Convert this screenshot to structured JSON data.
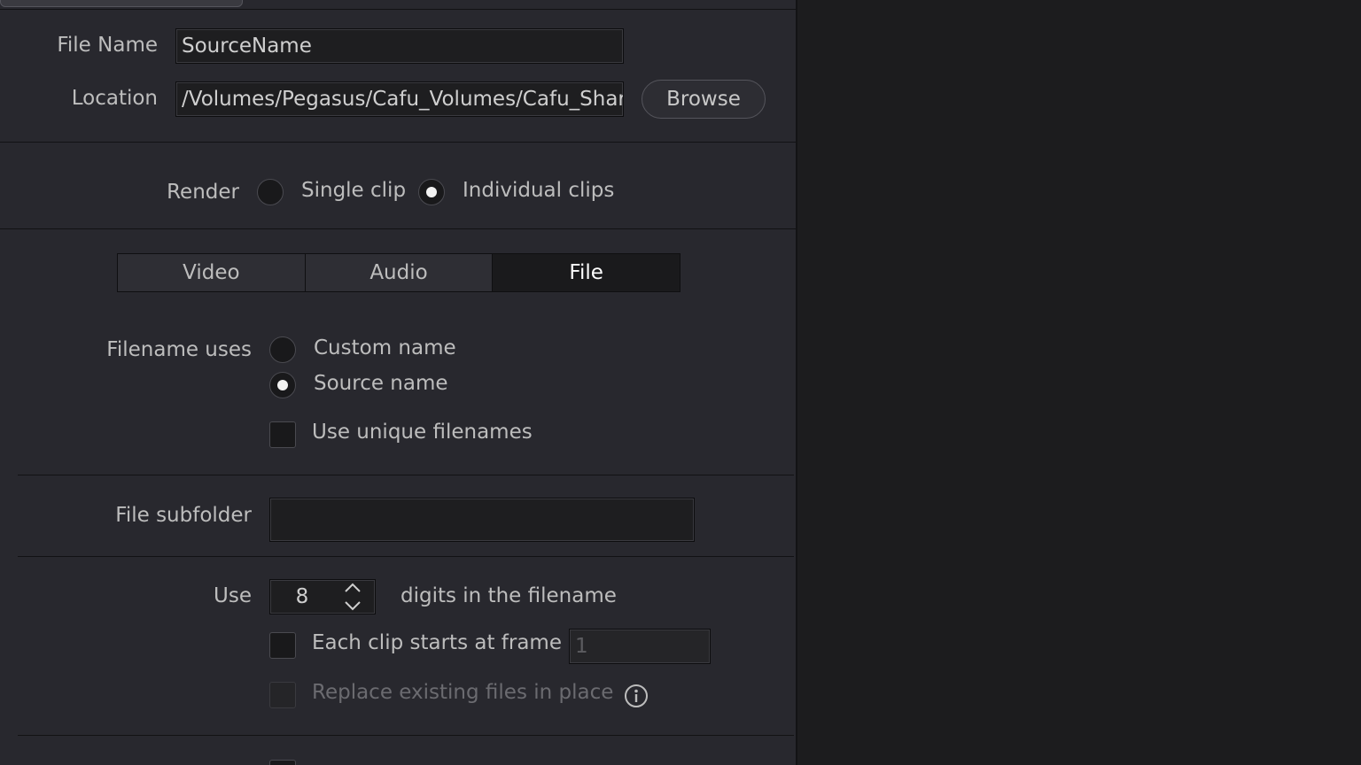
{
  "output": {
    "file_name_label": "File Name",
    "file_name_value": "SourceName",
    "location_label": "Location",
    "location_value": "/Volumes/Pegasus/Cafu_Volumes/Cafu_Shared",
    "browse_label": "Browse"
  },
  "render": {
    "label": "Render",
    "single_clip": "Single clip",
    "individual_clips": "Individual clips",
    "selected": "individual_clips"
  },
  "tabs": [
    {
      "label": "Video",
      "active": false
    },
    {
      "label": "Audio",
      "active": false
    },
    {
      "label": "File",
      "active": true
    }
  ],
  "file_settings": {
    "filename_uses_label": "Filename uses",
    "custom_name": "Custom name",
    "source_name": "Source name",
    "selected": "source_name",
    "unique_filenames_label": "Use unique filenames",
    "unique_filenames_checked": false,
    "subfolder_label": "File subfolder",
    "subfolder_value": "",
    "use_label": "Use",
    "digits_value": "8",
    "digits_suffix": "digits in the filename",
    "clip_start_label": "Each clip starts at frame",
    "clip_start_checked": false,
    "clip_start_value": "1",
    "replace_label": "Replace existing files in place",
    "replace_checked": false
  },
  "icons": {
    "info": "info-icon",
    "stepper_up": "chevron-up-icon",
    "stepper_down": "chevron-down-icon"
  },
  "colors": {
    "panel_bg": "#28282e",
    "right_bg": "#1c1c1e",
    "field_bg": "#1e1e20",
    "active_tab_bg": "#1a1a1c"
  }
}
